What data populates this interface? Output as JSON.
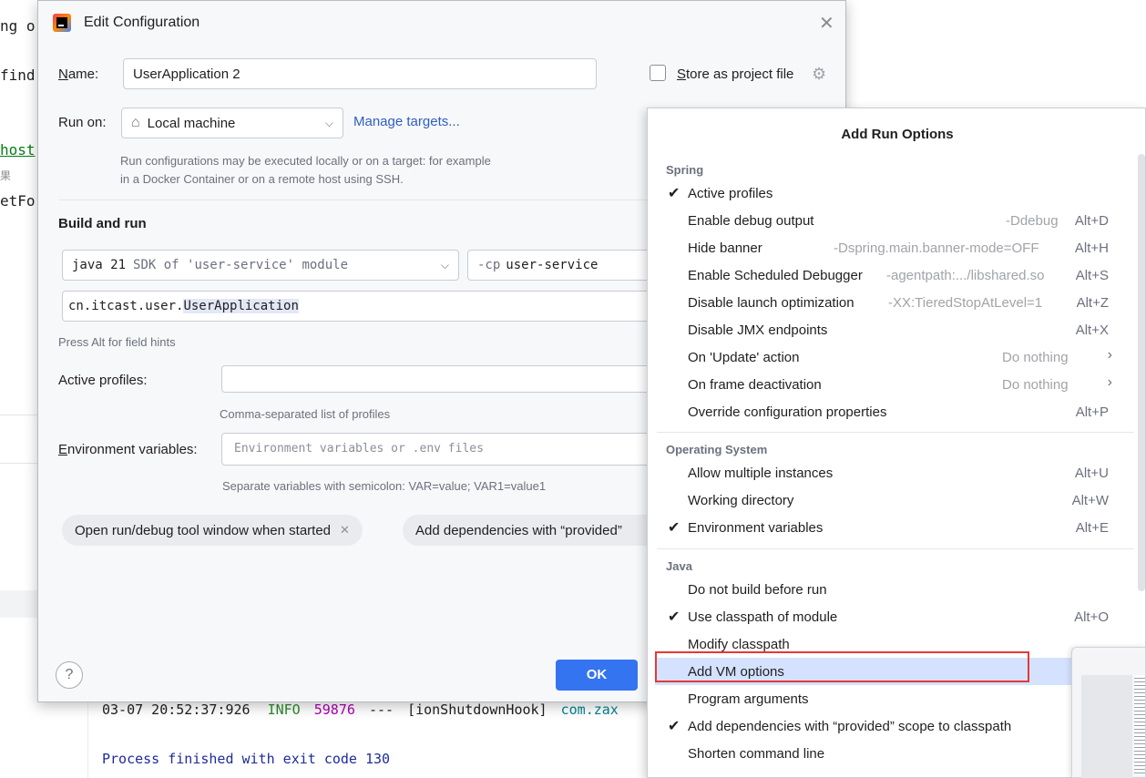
{
  "background": {
    "code_fragments": [
      "ng o",
      "find",
      "host",
      "果",
      "etFo"
    ],
    "console": {
      "timestamp": "03-07 20:52:37:926",
      "level": "INFO",
      "pid": "59876",
      "separator": "---",
      "thread": "[ionShutdownHook]",
      "logger": "com.zax",
      "exit_message": "Process finished with exit code 130"
    },
    "colors": {
      "string_green": "#067d17",
      "info_green": "#2a8c2a",
      "pid_magenta": "#b200b2",
      "exit_blue": "#1e2b9c"
    }
  },
  "dialog": {
    "title": "Edit Configuration",
    "close_glyph": "✕",
    "name_label": "Name:",
    "name_value": "UserApplication 2",
    "store_label": "Store as project file",
    "run_on_label": "Run on:",
    "run_on_value": "Local machine",
    "manage_targets": "Manage targets...",
    "run_on_hint": "Run configurations may be executed locally or on a target: for example in a Docker Container or on a remote host using SSH.",
    "build_and_run": "Build and run",
    "jdk_java": "java 21",
    "jdk_sdk": "SDK of 'user-service' module",
    "cp_flag": "-cp",
    "cp_value": "user-service",
    "main_class_prefix": "cn.itcast.user.",
    "main_class_name": "UserApplication",
    "alt_hint": "Press Alt for field hints",
    "active_profiles_label": "Active profiles:",
    "active_profiles_value": "",
    "active_profiles_hint": "Comma-separated list of profiles",
    "env_label": "Environment variables:",
    "env_placeholder": "Environment variables or .env files",
    "env_hint": "Separate variables with semicolon: VAR=value; VAR1=value1",
    "chips": [
      "Open run/debug tool window when started",
      "Add dependencies with “provided”"
    ],
    "help": "?",
    "ok": "OK",
    "accent": "#3574f0"
  },
  "popup": {
    "title": "Add Run Options",
    "sections": [
      {
        "title": "Spring",
        "items": [
          {
            "label": "Active profiles",
            "hint": "",
            "key": "",
            "checked": true,
            "arrow": false
          },
          {
            "label": "Enable debug output",
            "hint": "-Ddebug",
            "key": "Alt+D",
            "checked": false,
            "arrow": false
          },
          {
            "label": "Hide banner",
            "hint": "-Dspring.main.banner-mode=OFF",
            "key": "Alt+H",
            "checked": false,
            "arrow": false
          },
          {
            "label": "Enable Scheduled Debugger",
            "hint": "-agentpath:.../libshared.so",
            "key": "Alt+S",
            "checked": false,
            "arrow": false
          },
          {
            "label": "Disable launch optimization",
            "hint": "-XX:TieredStopAtLevel=1",
            "key": "Alt+Z",
            "checked": false,
            "arrow": false
          },
          {
            "label": "Disable JMX endpoints",
            "hint": "",
            "key": "Alt+X",
            "checked": false,
            "arrow": false
          },
          {
            "label": "On 'Update' action",
            "hint": "Do nothing",
            "key": "",
            "checked": false,
            "arrow": true
          },
          {
            "label": "On frame deactivation",
            "hint": "Do nothing",
            "key": "",
            "checked": false,
            "arrow": true
          },
          {
            "label": "Override configuration properties",
            "hint": "",
            "key": "Alt+P",
            "checked": false,
            "arrow": false
          }
        ]
      },
      {
        "title": "Operating System",
        "items": [
          {
            "label": "Allow multiple instances",
            "hint": "",
            "key": "Alt+U",
            "checked": false,
            "arrow": false
          },
          {
            "label": "Working directory",
            "hint": "",
            "key": "Alt+W",
            "checked": false,
            "arrow": false
          },
          {
            "label": "Environment variables",
            "hint": "",
            "key": "Alt+E",
            "checked": true,
            "arrow": false
          }
        ]
      },
      {
        "title": "Java",
        "items": [
          {
            "label": "Do not build before run",
            "hint": "",
            "key": "",
            "checked": false,
            "arrow": false
          },
          {
            "label": "Use classpath of module",
            "hint": "",
            "key": "Alt+O",
            "checked": true,
            "arrow": false
          },
          {
            "label": "Modify classpath",
            "hint": "",
            "key": "",
            "checked": false,
            "arrow": false
          },
          {
            "label": "Add VM options",
            "hint": "",
            "key": "",
            "checked": false,
            "arrow": false,
            "selected": true
          },
          {
            "label": "Program arguments",
            "hint": "",
            "key": "",
            "checked": false,
            "arrow": false
          },
          {
            "label": "Add dependencies with “provided” scope to classpath",
            "hint": "",
            "key": "",
            "checked": true,
            "arrow": false
          },
          {
            "label": "Shorten command line",
            "hint": "",
            "key": "",
            "checked": false,
            "arrow": false
          }
        ]
      }
    ],
    "highlight_color": "#d4e2ff",
    "annotation_color": "#e53935"
  }
}
